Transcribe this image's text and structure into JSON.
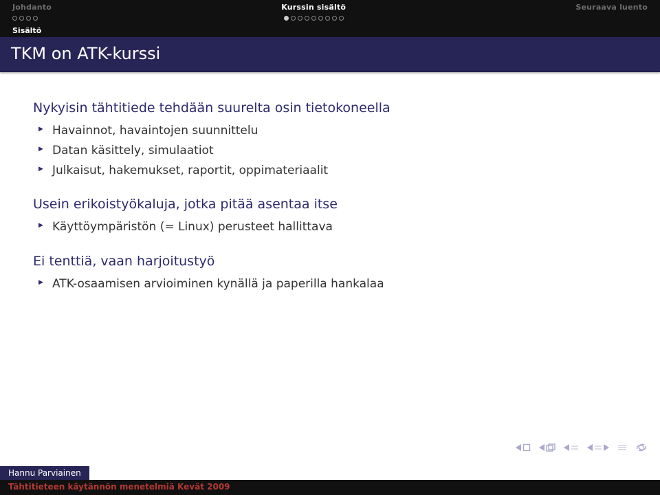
{
  "header": {
    "sections": [
      {
        "label": "Johdanto",
        "active": false,
        "dots_total": 4,
        "dots_filled": 0
      },
      {
        "label": "Kurssin sisältö",
        "active": true,
        "dots_total": 9,
        "dots_filled": 1
      },
      {
        "label": "Seuraava luento",
        "active": false,
        "dots_total": 0,
        "dots_filled": 0
      }
    ],
    "subsection": "Sisältö"
  },
  "title": "TKM on ATK-kurssi",
  "blocks": [
    {
      "lead": "Nykyisin tähtitiede tehdään suurelta osin tietokoneella",
      "items": [
        "Havainnot, havaintojen suunnittelu",
        "Datan käsittely, simulaatiot",
        "Julkaisut, hakemukset, raportit, oppimateriaalit"
      ]
    },
    {
      "lead": "Usein erikoistyökaluja, jotka pitää asentaa itse",
      "items": [
        "Käyttöympäristön (= Linux) perusteet hallittava"
      ]
    },
    {
      "lead": "Ei tenttiä, vaan harjoitustyö",
      "items": [
        "ATK-osaamisen arvioiminen kynällä ja paperilla hankalaa"
      ]
    }
  ],
  "footer": {
    "author": "Hannu Parviainen",
    "course": "Tähtitieteen käytännön menetelmiä Kevät 2009"
  }
}
